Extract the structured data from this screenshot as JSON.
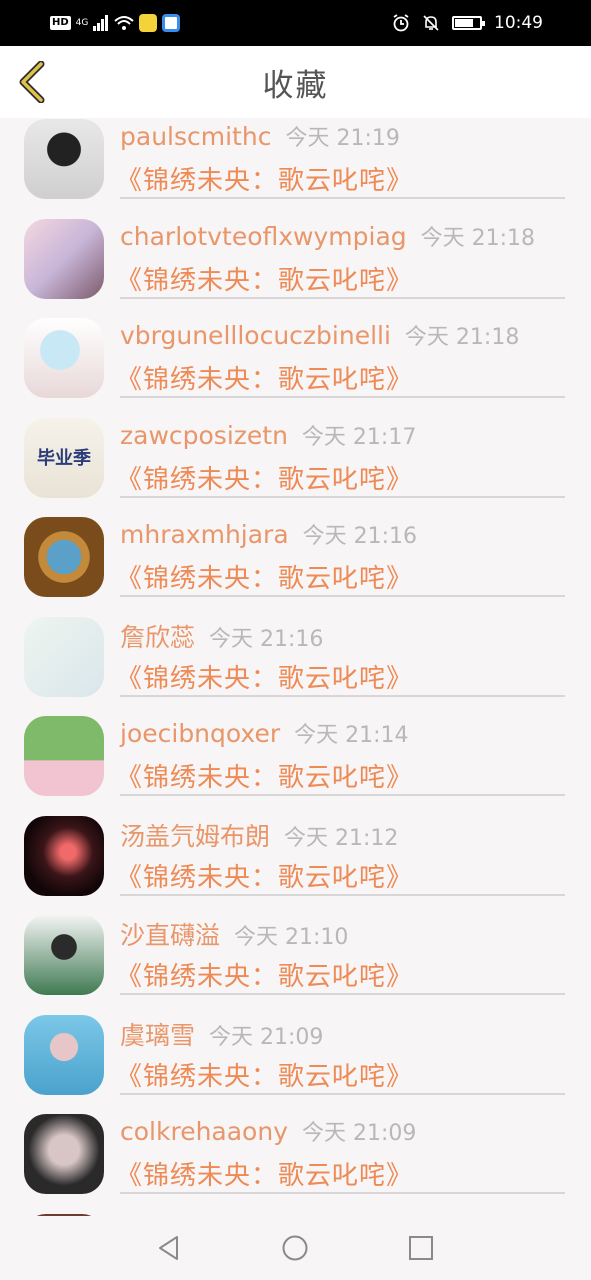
{
  "status_bar": {
    "network": "HD",
    "signal_label": "4G",
    "time": "10:49"
  },
  "header": {
    "title": "收藏",
    "back_icon": "chevron-left-icon",
    "accent_color": "#e0c24a"
  },
  "colors": {
    "name": "#e8966a",
    "time": "#b8b8b8",
    "book": "#ee8a55",
    "divider": "#d8d6d6"
  },
  "favorites": [
    {
      "name": "paulscmithc",
      "time": "今天 21:19",
      "book": "《锦绣未央：歌云叱咤》"
    },
    {
      "name": "charlotvteoflxwympiag",
      "time": "今天 21:18",
      "book": "《锦绣未央：歌云叱咤》"
    },
    {
      "name": "vbrgunelllocuczbinelli",
      "time": "今天 21:18",
      "book": "《锦绣未央：歌云叱咤》"
    },
    {
      "name": "zawcposizetn",
      "time": "今天 21:17",
      "book": "《锦绣未央：歌云叱咤》"
    },
    {
      "name": "mhraxmhjara",
      "time": "今天 21:16",
      "book": "《锦绣未央：歌云叱咤》"
    },
    {
      "name": "詹欣蕊",
      "time": "今天 21:16",
      "book": "《锦绣未央：歌云叱咤》"
    },
    {
      "name": "joecibnqoxer",
      "time": "今天 21:14",
      "book": "《锦绣未央：歌云叱咤》"
    },
    {
      "name": "汤盖氕姆布朗",
      "time": "今天 21:12",
      "book": "《锦绣未央：歌云叱咤》"
    },
    {
      "name": "沙直礴溢",
      "time": "今天 21:10",
      "book": "《锦绣未央：歌云叱咤》"
    },
    {
      "name": "虞璃雪",
      "time": "今天 21:09",
      "book": "《锦绣未央：歌云叱咤》"
    },
    {
      "name": "colkrehaaony",
      "time": "今天 21:09",
      "book": "《锦绣未央：歌云叱咤》"
    }
  ],
  "avatar_text": "毕业季",
  "nav_bar": {
    "back_icon": "triangle-back-icon",
    "home_icon": "circle-home-icon",
    "recents_icon": "square-recents-icon"
  }
}
